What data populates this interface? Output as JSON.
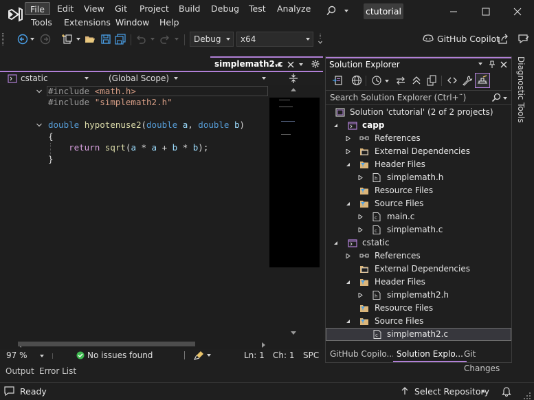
{
  "menu": {
    "items": [
      "File",
      "Edit",
      "View",
      "Git",
      "Project",
      "Build",
      "Debug",
      "Test",
      "Analyze",
      "Tools",
      "Extensions",
      "Window",
      "Help"
    ],
    "active": "File"
  },
  "title": {
    "solution_name": "ctutorial"
  },
  "toolbar": {
    "config": "Debug",
    "platform": "x64",
    "copilot_label": "GitHub Copilot"
  },
  "editor": {
    "tab_name": "simplemath2.c",
    "project_combo": "cstatic",
    "scope_combo": "(Global Scope)",
    "code": {
      "l1_directive": "#include",
      "l1_header": "<math.h>",
      "l2_directive": "#include",
      "l2_header": "\"simplemath2.h\"",
      "l4_type": "double",
      "l4_fn": "hypotenuse2",
      "l4_open": "(",
      "l4_ptype1": "double",
      "l4_p1": "a",
      "l4_comma": ",",
      "l4_ptype2": "double",
      "l4_p2": "b",
      "l4_close": ")",
      "l5": "{",
      "l6_kw": "return",
      "l6_fn": "sqrt",
      "l6_rest_open": "(",
      "l6_a1": "a",
      "l6_op1": " * ",
      "l6_a2": "a",
      "l6_op2": " + ",
      "l6_b1": "b",
      "l6_op3": " * ",
      "l6_b2": "b",
      "l6_end": ");",
      "l7": "}"
    },
    "status": {
      "zoom": "97 %",
      "issues": "No issues found",
      "line": "Ln: 1",
      "col": "Ch: 1",
      "mode": "SPC"
    }
  },
  "solution_explorer": {
    "title": "Solution Explorer",
    "search_placeholder": "Search Solution Explorer (Ctrl+¨)",
    "solution_label": "Solution 'ctutorial' (2 of 2 projects)",
    "rows": {
      "capp": "capp",
      "capp_refs": "References",
      "capp_ext": "External Dependencies",
      "capp_headers": "Header Files",
      "capp_h1": "simplemath.h",
      "capp_res": "Resource Files",
      "capp_src": "Source Files",
      "capp_main": "main.c",
      "capp_sm": "simplemath.c",
      "cstatic": "cstatic",
      "cs_refs": "References",
      "cs_ext": "External Dependencies",
      "cs_headers": "Header Files",
      "cs_h1": "simplemath2.h",
      "cs_res": "Resource Files",
      "cs_src": "Source Files",
      "cs_sm2": "simplemath2.c"
    },
    "tabs": [
      "GitHub Copilo...",
      "Solution Explo...",
      "Git Changes"
    ]
  },
  "side": {
    "diagnostic_tools": "Diagnostic Tools"
  },
  "bottom_tabs": [
    "Output",
    "Error List"
  ],
  "statusbar": {
    "ready": "Ready",
    "repo": "Select Repository"
  },
  "colors": {
    "accent": "#b180d7",
    "keyword": "#569cd6",
    "function": "#dcdcaa",
    "string": "#d69d85",
    "folder": "#dcb67a",
    "ok_green": "#3fb950"
  }
}
